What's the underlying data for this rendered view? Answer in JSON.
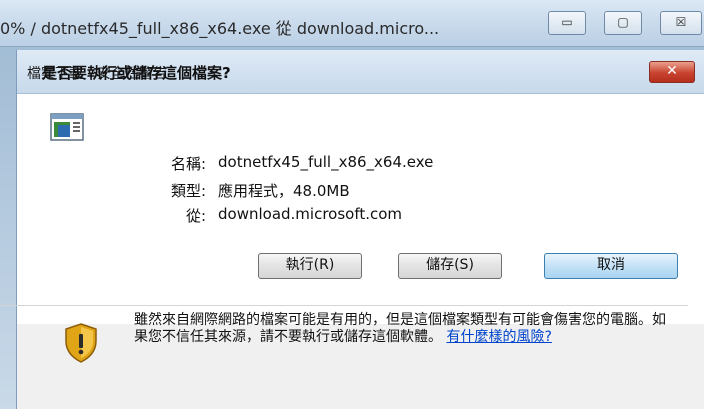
{
  "outer_window": {
    "title": "0% / dotnetfx45_full_x86_x64.exe 從 download.micro...",
    "minimize_glyph": "▭",
    "maximize_glyph": "▢",
    "close_glyph": "☒"
  },
  "dialog": {
    "title": "檔案下載 - 安全性警告",
    "close_glyph": "✕",
    "question": "是否要執行或儲存這個檔案?",
    "fields": {
      "name_label": "名稱:",
      "name_value": "dotnetfx45_full_x86_x64.exe",
      "type_label": "類型:",
      "type_value": "應用程式，48.0MB",
      "from_label": "從:",
      "from_value": "download.microsoft.com"
    },
    "buttons": {
      "run": "執行(R)",
      "save": "儲存(S)",
      "cancel": "取消"
    },
    "warning": {
      "text": "雖然來自網際網路的檔案可能是有用的，但是這個檔案類型有可能會傷害您的電腦。如果您不信任其來源，請不要執行或儲存這個軟體。",
      "link": "有什麼樣的風險?"
    }
  },
  "colors": {
    "link": "#0044cc",
    "close_red": "#c8432f",
    "shield_gold": "#e0a516",
    "cancel_blue": "#3c7fb1"
  },
  "icons": [
    "file-icon",
    "shield-warning-icon",
    "close-icon"
  ]
}
